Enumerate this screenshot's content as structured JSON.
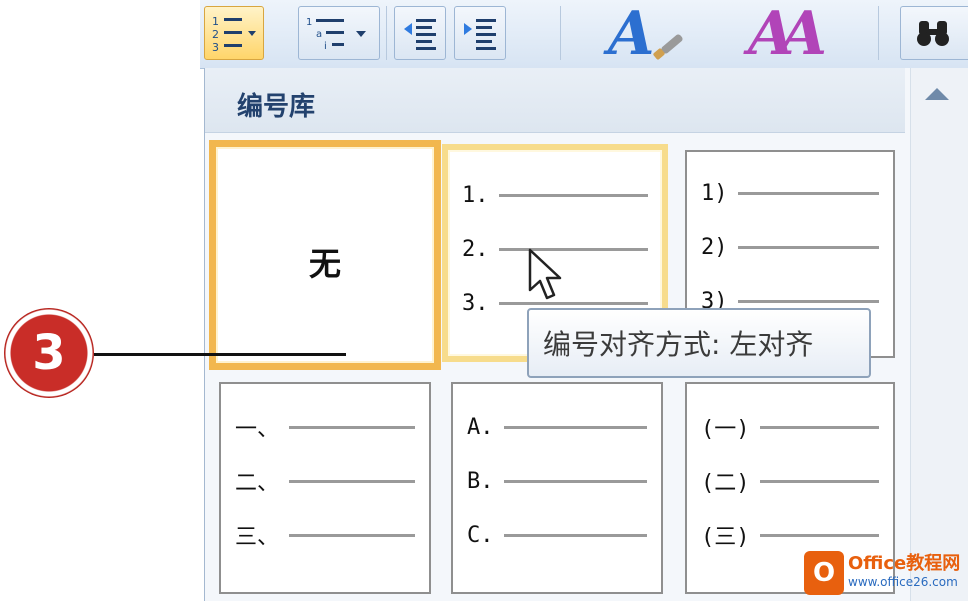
{
  "ribbon": {
    "numbering_button_icon": "numbering-list-icon",
    "numbering_dropdown_icon": "chevron-down-icon",
    "multilevel_icon": "multilevel-list-icon",
    "decrease_indent_icon": "decrease-indent-icon",
    "increase_indent_icon": "increase-indent-icon",
    "style_a_glyph": "A",
    "style_aa_glyph": "AA",
    "find_icon": "binoculars-icon"
  },
  "gallery": {
    "title": "编号库",
    "tiles": [
      {
        "label": "无"
      },
      {
        "items": [
          "1.",
          "2.",
          "3."
        ]
      },
      {
        "items": [
          "1)",
          "2)",
          "3)"
        ]
      },
      {
        "items": [
          "一、",
          "二、",
          "三、"
        ]
      },
      {
        "items": [
          "A.",
          "B.",
          "C."
        ]
      },
      {
        "items": [
          "(一)",
          "(二)",
          "(三)"
        ]
      }
    ]
  },
  "tooltip": {
    "text": "编号对齐方式: 左对齐"
  },
  "callout": {
    "step": "3"
  },
  "watermark": {
    "logo_glyph": "O",
    "brand": "Office教程网",
    "url": "www.office26.com"
  },
  "colors": {
    "selected_border": "#f2b74e",
    "hover_border": "#f7dc8c",
    "ribbon_bg": "#d7e4f3",
    "callout_red": "#c92d28"
  }
}
